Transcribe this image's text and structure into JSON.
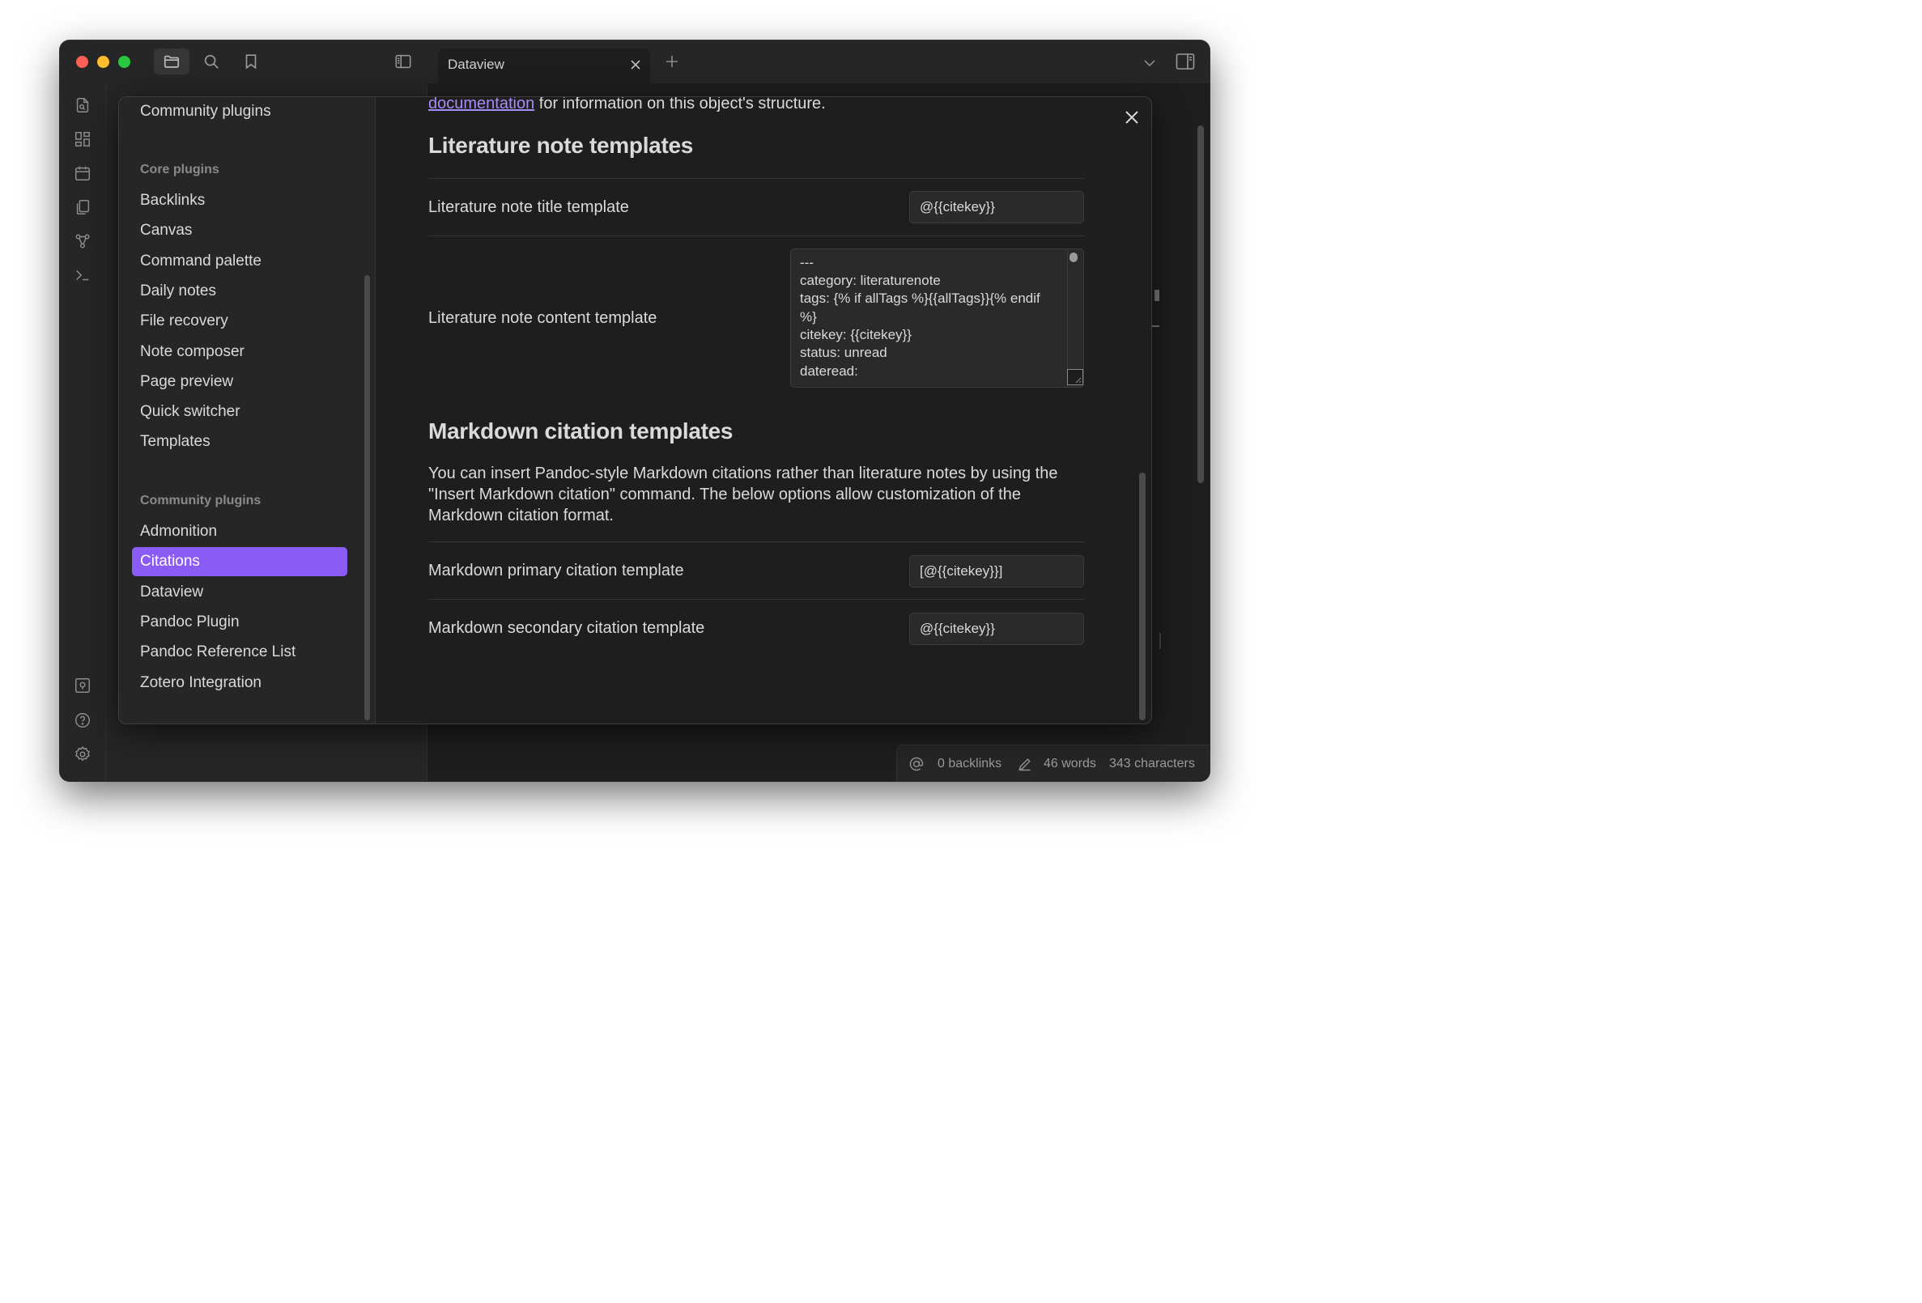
{
  "titlebar": {
    "tab_title": "Dataview",
    "left_icons": [
      "folder-icon",
      "search-icon",
      "bookmark-icon",
      "sidebar-toggle-icon"
    ],
    "right_icons": [
      "chevron-down-icon",
      "right-sidebar-toggle-icon"
    ]
  },
  "ribbon": {
    "icons": [
      "open-quick-switcher-icon",
      "dashboard-icon",
      "calendar-icon",
      "copy-pages-icon",
      "graph-icon",
      "terminal-icon",
      "vault-icon",
      "help-icon",
      "settings-icon"
    ]
  },
  "settings_nav": {
    "top_item": "Community plugins",
    "core_heading": "Core plugins",
    "core_items": [
      "Backlinks",
      "Canvas",
      "Command palette",
      "Daily notes",
      "File recovery",
      "Note composer",
      "Page preview",
      "Quick switcher",
      "Templates"
    ],
    "community_heading": "Community plugins",
    "community_items": [
      "Admonition",
      "Citations",
      "Dataview",
      "Pandoc Plugin",
      "Pandoc Reference List",
      "Zotero Integration"
    ],
    "active_item": "Citations"
  },
  "content": {
    "intro_link": "documentation",
    "intro_rest": " for information on this object's structure.",
    "literature_heading": "Literature note templates",
    "title_template_label": "Literature note title template",
    "title_template_value": "@{{citekey}}",
    "content_template_label": "Literature note content template",
    "content_template_lines": [
      "---",
      "category: literaturenote",
      "tags: {% if allTags %}{{allTags}}{% endif",
      "%}",
      "citekey: {{citekey}}",
      "status: unread",
      "dateread:"
    ],
    "markdown_heading": "Markdown citation templates",
    "markdown_description": "You can insert Pandoc-style Markdown citations rather than literature notes by using the \"Insert Markdown citation\" command. The below options allow customization of the Markdown citation format.",
    "primary_label": "Markdown primary citation template",
    "primary_value": "[@{{citekey}}]",
    "secondary_label": "Markdown secondary citation template",
    "secondary_value": "@{{citekey}}"
  },
  "statusbar": {
    "backlinks": "0 backlinks",
    "words": "46 words",
    "characters": "343 characters"
  },
  "colors": {
    "accent": "#8a5cf5",
    "link": "#a88bfa",
    "background": "#1e1e1e",
    "sidebar": "#262626"
  }
}
